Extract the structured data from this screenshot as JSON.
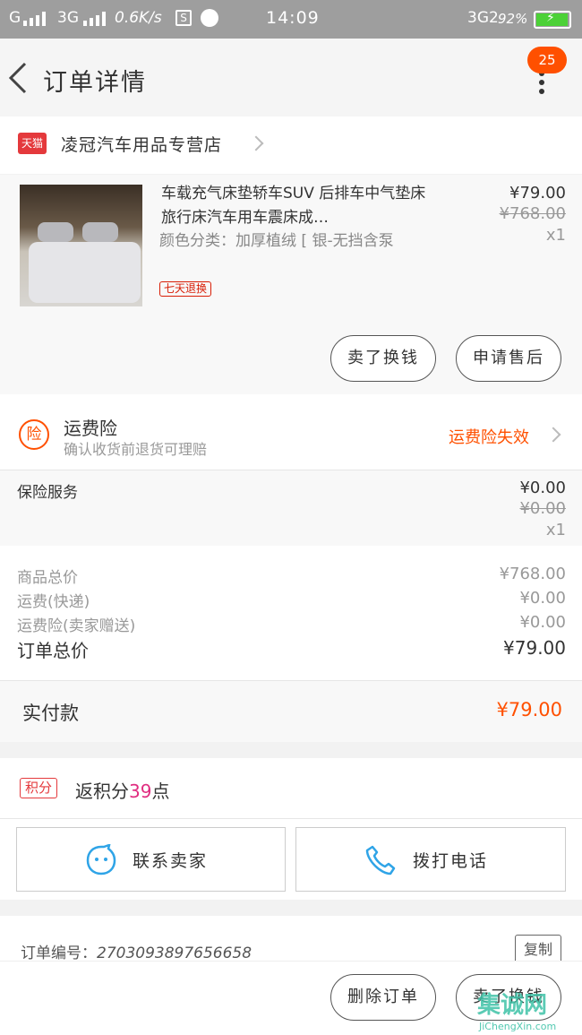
{
  "status_bar": {
    "carrier1": "G",
    "carrier2": "3G",
    "speed": "0.6K/s",
    "s_icon": "S",
    "time": "14:09",
    "net": "3G2",
    "battery": "92%"
  },
  "header": {
    "title": "订单详情",
    "badge": "25"
  },
  "shop": {
    "tmall_label": "天猫",
    "name": "凌冠汽车用品专营店"
  },
  "product": {
    "name": "车载充气床垫轿车SUV 后排车中气垫床旅行床汽车用车震床成…",
    "spec": "颜色分类：加厚植绒 [ 银-无挡含泵",
    "tag": "七天退换",
    "price": "¥79.00",
    "original_price": "¥768.00",
    "qty": "x1",
    "btn_rebuy": "卖了换钱",
    "btn_aftersale": "申请售后"
  },
  "insurance": {
    "icon_label": "险",
    "title": "运费险",
    "subtitle": "确认收货前退货可理赔",
    "status": "运费险失效"
  },
  "service": {
    "label": "保险服务",
    "price": "¥0.00",
    "original_price": "¥0.00",
    "qty": "x1"
  },
  "summary": {
    "goods_total_label": "商品总价",
    "goods_total": "¥768.00",
    "shipping_label": "运费(快递)",
    "shipping": "¥0.00",
    "insurance_label": "运费险(卖家赠送)",
    "insurance": "¥0.00",
    "order_total_label": "订单总价",
    "order_total": "¥79.00"
  },
  "paid": {
    "label": "实付款",
    "amount": "¥79.00"
  },
  "points": {
    "tag": "积分",
    "prefix": "返积分",
    "count": "39",
    "suffix": "点"
  },
  "contact": {
    "seller_label": "联系卖家",
    "phone_label": "拨打电话"
  },
  "order": {
    "number_label": "订单编号：",
    "number": "2703093897656658",
    "copy_label": "复制"
  },
  "footer": {
    "delete_label": "删除订单",
    "sell_label": "卖了换钱"
  },
  "watermark": {
    "top": "集诚网",
    "bottom": "JiChengXin.com"
  },
  "colors": {
    "accent": "#ff5000",
    "tmall_red": "#e4393c",
    "points_pink": "#e02d80",
    "contact_blue": "#2fa4e7"
  }
}
